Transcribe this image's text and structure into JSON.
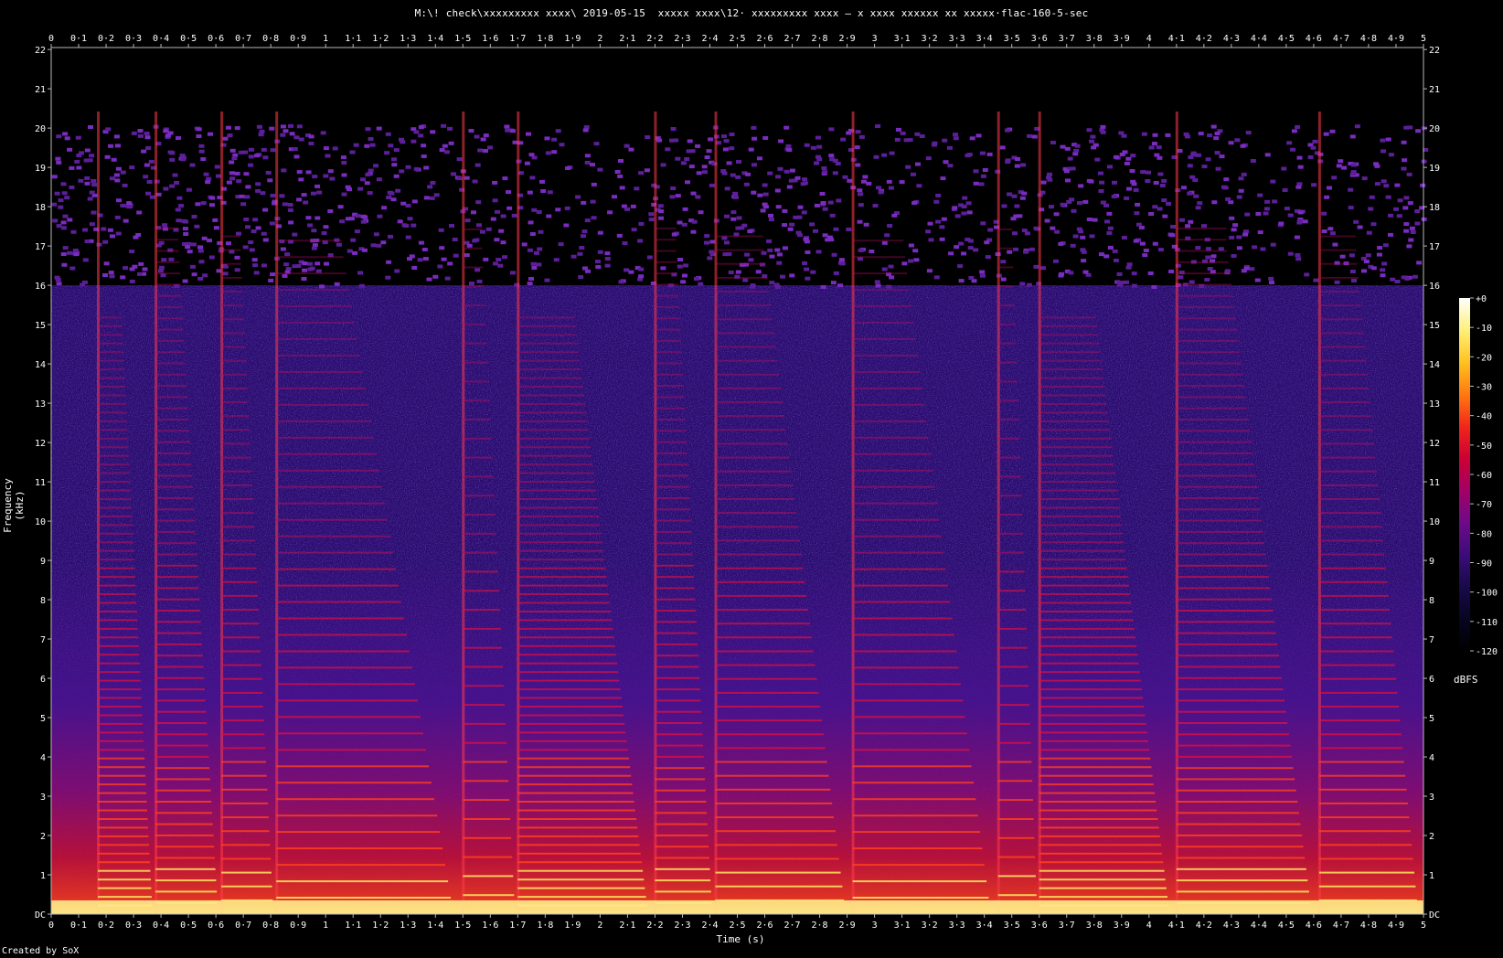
{
  "header": {
    "title": "M:\\! check\\xxxxxxxxx xxxx\\ 2019-05-15  xxxxx xxxx\\12· xxxxxxxxx xxxx – x xxxx xxxxxx xx xxxxx·flac-160-5-sec"
  },
  "footer": {
    "credit": "Created by SoX"
  },
  "chart_data": {
    "type": "heatmap",
    "title": "M:\\! check\\xxxxxxxxx xxxx\\ 2019-05-15  xxxxx xxxx\\12· xxxxxxxxx xxxx – x xxxx xxxxxx xx xxxxx·flac-160-5-sec",
    "xlabel": "Time (s)",
    "ylabel": "Frequency (kHz)",
    "xlim": [
      0,
      5
    ],
    "ylim": [
      0,
      22.05
    ],
    "x_ticks": [
      "0",
      "0·1",
      "0·2",
      "0·3",
      "0·4",
      "0·5",
      "0·6",
      "0·7",
      "0·8",
      "0·9",
      "1",
      "1·1",
      "1·2",
      "1·3",
      "1·4",
      "1·5",
      "1·6",
      "1·7",
      "1·8",
      "1·9",
      "2",
      "2·1",
      "2·2",
      "2·3",
      "2·4",
      "2·5",
      "2·6",
      "2·7",
      "2·8",
      "2·9",
      "3",
      "3·1",
      "3·2",
      "3·3",
      "3·4",
      "3·5",
      "3·6",
      "3·7",
      "3·8",
      "3·9",
      "4",
      "4·1",
      "4·2",
      "4·3",
      "4·4",
      "4·5",
      "4·6",
      "4·7",
      "4·8",
      "4·9",
      "5"
    ],
    "y_ticks": [
      "DC",
      "1",
      "2",
      "3",
      "4",
      "5",
      "6",
      "7",
      "8",
      "9",
      "10",
      "11",
      "12",
      "13",
      "14",
      "15",
      "16",
      "17",
      "18",
      "19",
      "20",
      "21",
      "22"
    ],
    "colorbar": {
      "label": "dBFS",
      "range": [
        -120,
        0
      ],
      "ticks": [
        "+0",
        "-10",
        "-20",
        "-30",
        "-40",
        "-50",
        "-60",
        "-70",
        "-80",
        "-90",
        "-100",
        "-110",
        "-120"
      ],
      "colors": [
        "#ffffff",
        "#fff07a",
        "#ffc21e",
        "#ff7a10",
        "#f2261a",
        "#cc0033",
        "#a30066",
        "#6e0a88",
        "#3c0c7a",
        "#190a4a",
        "#070522",
        "#000000"
      ]
    },
    "lowpass_cutoff_khz": 16,
    "onsets_s": [
      0.17,
      0.38,
      0.62,
      0.82,
      1.5,
      1.7,
      2.2,
      2.42,
      2.92,
      3.45,
      3.6,
      4.1,
      4.62
    ],
    "colormap": "sox-spectrogram"
  }
}
